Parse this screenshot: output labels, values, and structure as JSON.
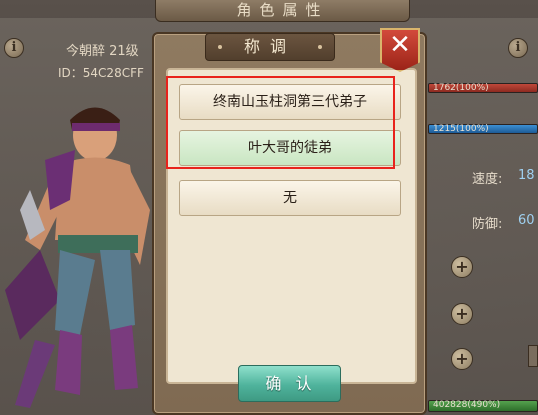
{
  "background": {
    "panel_title": "角色属性",
    "player_name": "今朝醉 21级",
    "player_id": "ID：54C28CFF",
    "hp_bar": "1762(100%)",
    "mp_bar": "1215(100%)",
    "exp_bar": "402828(490%)",
    "stats": [
      {
        "label": "速度:",
        "value": "18"
      },
      {
        "label": "防御:",
        "value": "60"
      }
    ],
    "plus_label": "+",
    "info_label": "i"
  },
  "dialog": {
    "title": "称调",
    "close_label": "✕",
    "options": [
      "终南山玉柱洞第三代弟子",
      "叶大哥的徒弟",
      "无"
    ],
    "confirm_label": "确认"
  },
  "colors": {
    "highlight": "#e8231c",
    "confirm_button": "#4fb39c",
    "close_badge": "#c0392b",
    "selected_option": "#d4ecce"
  }
}
